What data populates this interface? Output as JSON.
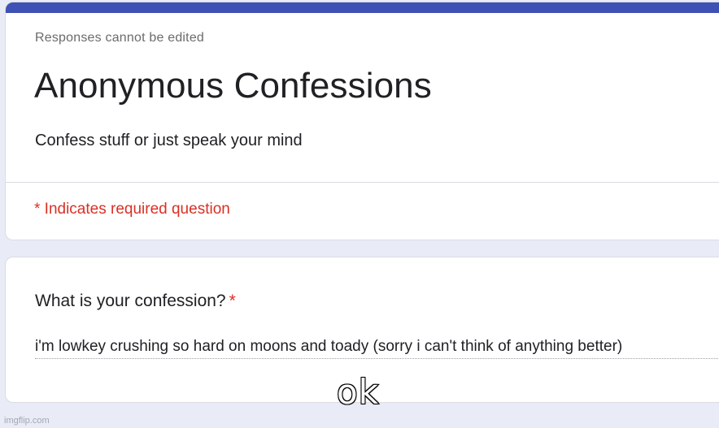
{
  "header": {
    "responses_note": "Responses cannot be edited",
    "title": "Anonymous Confessions",
    "description": "Confess stuff or just speak your mind",
    "required_note": "* Indicates required question",
    "accent_color": "#3f51b5"
  },
  "question": {
    "title": "What is your confession?",
    "required_marker": "*",
    "answer": "i'm lowkey crushing so hard on moons and toady (sorry i can't think of anything better)"
  },
  "overlay": {
    "caption": "ok",
    "watermark": "imgflip.com"
  },
  "colors": {
    "background": "#e9ecf6",
    "required_red": "#d93025",
    "text": "#202124"
  }
}
